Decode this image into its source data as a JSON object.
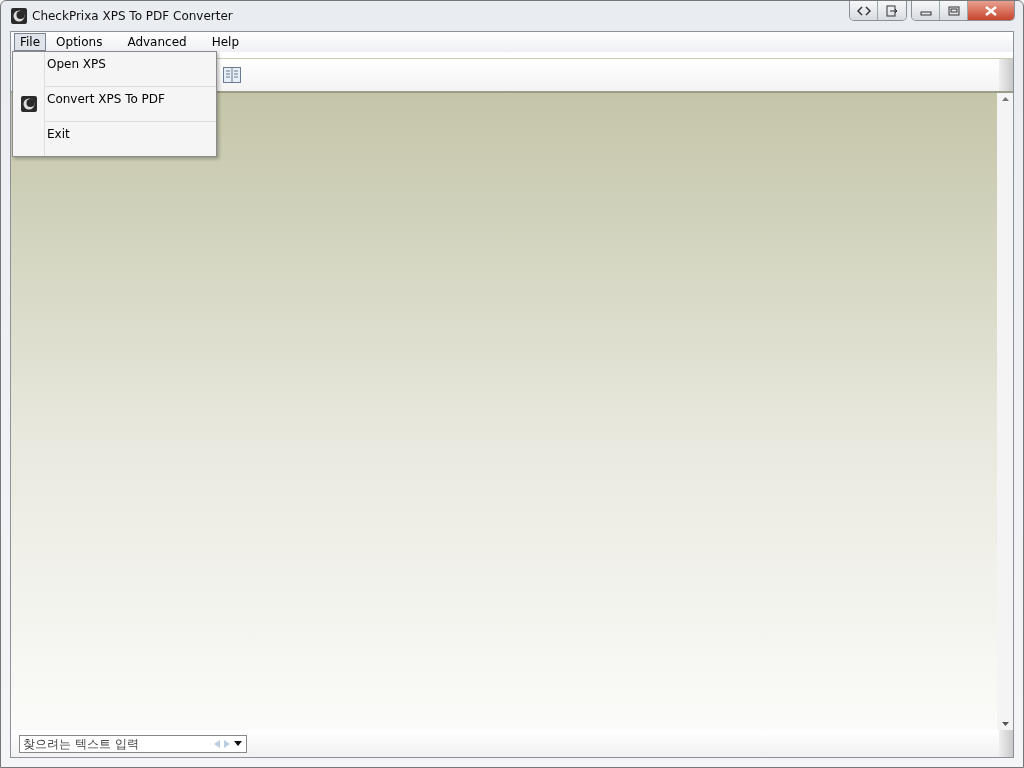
{
  "window": {
    "title": "CheckPrixa XPS To PDF Converter"
  },
  "menu": [
    {
      "label": "File",
      "selected": true
    },
    {
      "label": "Options",
      "selected": false
    },
    {
      "label": "Advanced",
      "selected": false
    },
    {
      "label": "Help",
      "selected": false
    }
  ],
  "file_menu": [
    {
      "label": "Open XPS",
      "kind": "plain"
    },
    {
      "label": "Convert XPS To PDF",
      "kind": "app_icon"
    },
    {
      "label": "Exit",
      "kind": "plain"
    }
  ],
  "find_bar": {
    "placeholder": "찾으려는 텍스트 입력"
  }
}
